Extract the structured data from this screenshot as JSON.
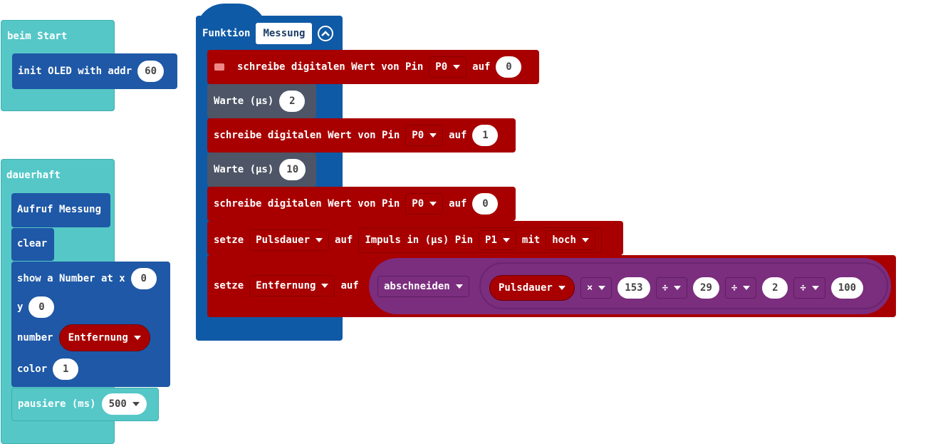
{
  "on_start": {
    "hat_label": "beim Start",
    "init_oled_label": "init OLED with addr",
    "init_oled_addr": "60"
  },
  "forever": {
    "hat_label": "dauerhaft",
    "call_label": "Aufruf Messung",
    "clear_label": "clear",
    "show_number_label": "show a Number at x",
    "show_number_x": "0",
    "y_label": "y",
    "y_value": "0",
    "number_label": "number",
    "number_variable": "Entfernung",
    "color_label": "color",
    "color_value": "1",
    "pause_label": "pausiere (ms)",
    "pause_value": "500"
  },
  "function": {
    "keyword": "Funktion",
    "name": "Messung",
    "blocks": {
      "write1": {
        "label": "schreibe digitalen Wert von Pin",
        "pin": "P0",
        "to": "auf",
        "value": "0"
      },
      "wait1": {
        "label": "Warte (µs)",
        "value": "2"
      },
      "write2": {
        "label": "schreibe digitalen Wert von Pin",
        "pin": "P0",
        "to": "auf",
        "value": "1"
      },
      "wait2": {
        "label": "Warte (µs)",
        "value": "10"
      },
      "write3": {
        "label": "schreibe digitalen Wert von Pin",
        "pin": "P0",
        "to": "auf",
        "value": "0"
      },
      "set1": {
        "label": "setze",
        "variable": "Pulsdauer",
        "to": "auf",
        "pulse_label": "Impuls in (µs) Pin",
        "pin": "P1",
        "with": "mit",
        "level": "hoch"
      },
      "set2": {
        "label": "setze",
        "variable": "Entfernung",
        "to": "auf",
        "truncate": "abschneiden",
        "var": "Pulsdauer",
        "op1": "×",
        "v1": "153",
        "op2": "÷",
        "v2": "29",
        "op3": "÷",
        "v3": "2",
        "op4": "÷",
        "v4": "100"
      }
    }
  },
  "colors": {
    "start_teal": "#55C7C7",
    "oled_blue": "#1E58A6",
    "function_blue": "#0F5AA6",
    "pins_red": "#A80000",
    "wait_gray": "#4D5566",
    "math_purple": "#7B2D7E"
  },
  "icons": {
    "comment": "comment-icon",
    "collapse": "chevron-up-icon"
  }
}
